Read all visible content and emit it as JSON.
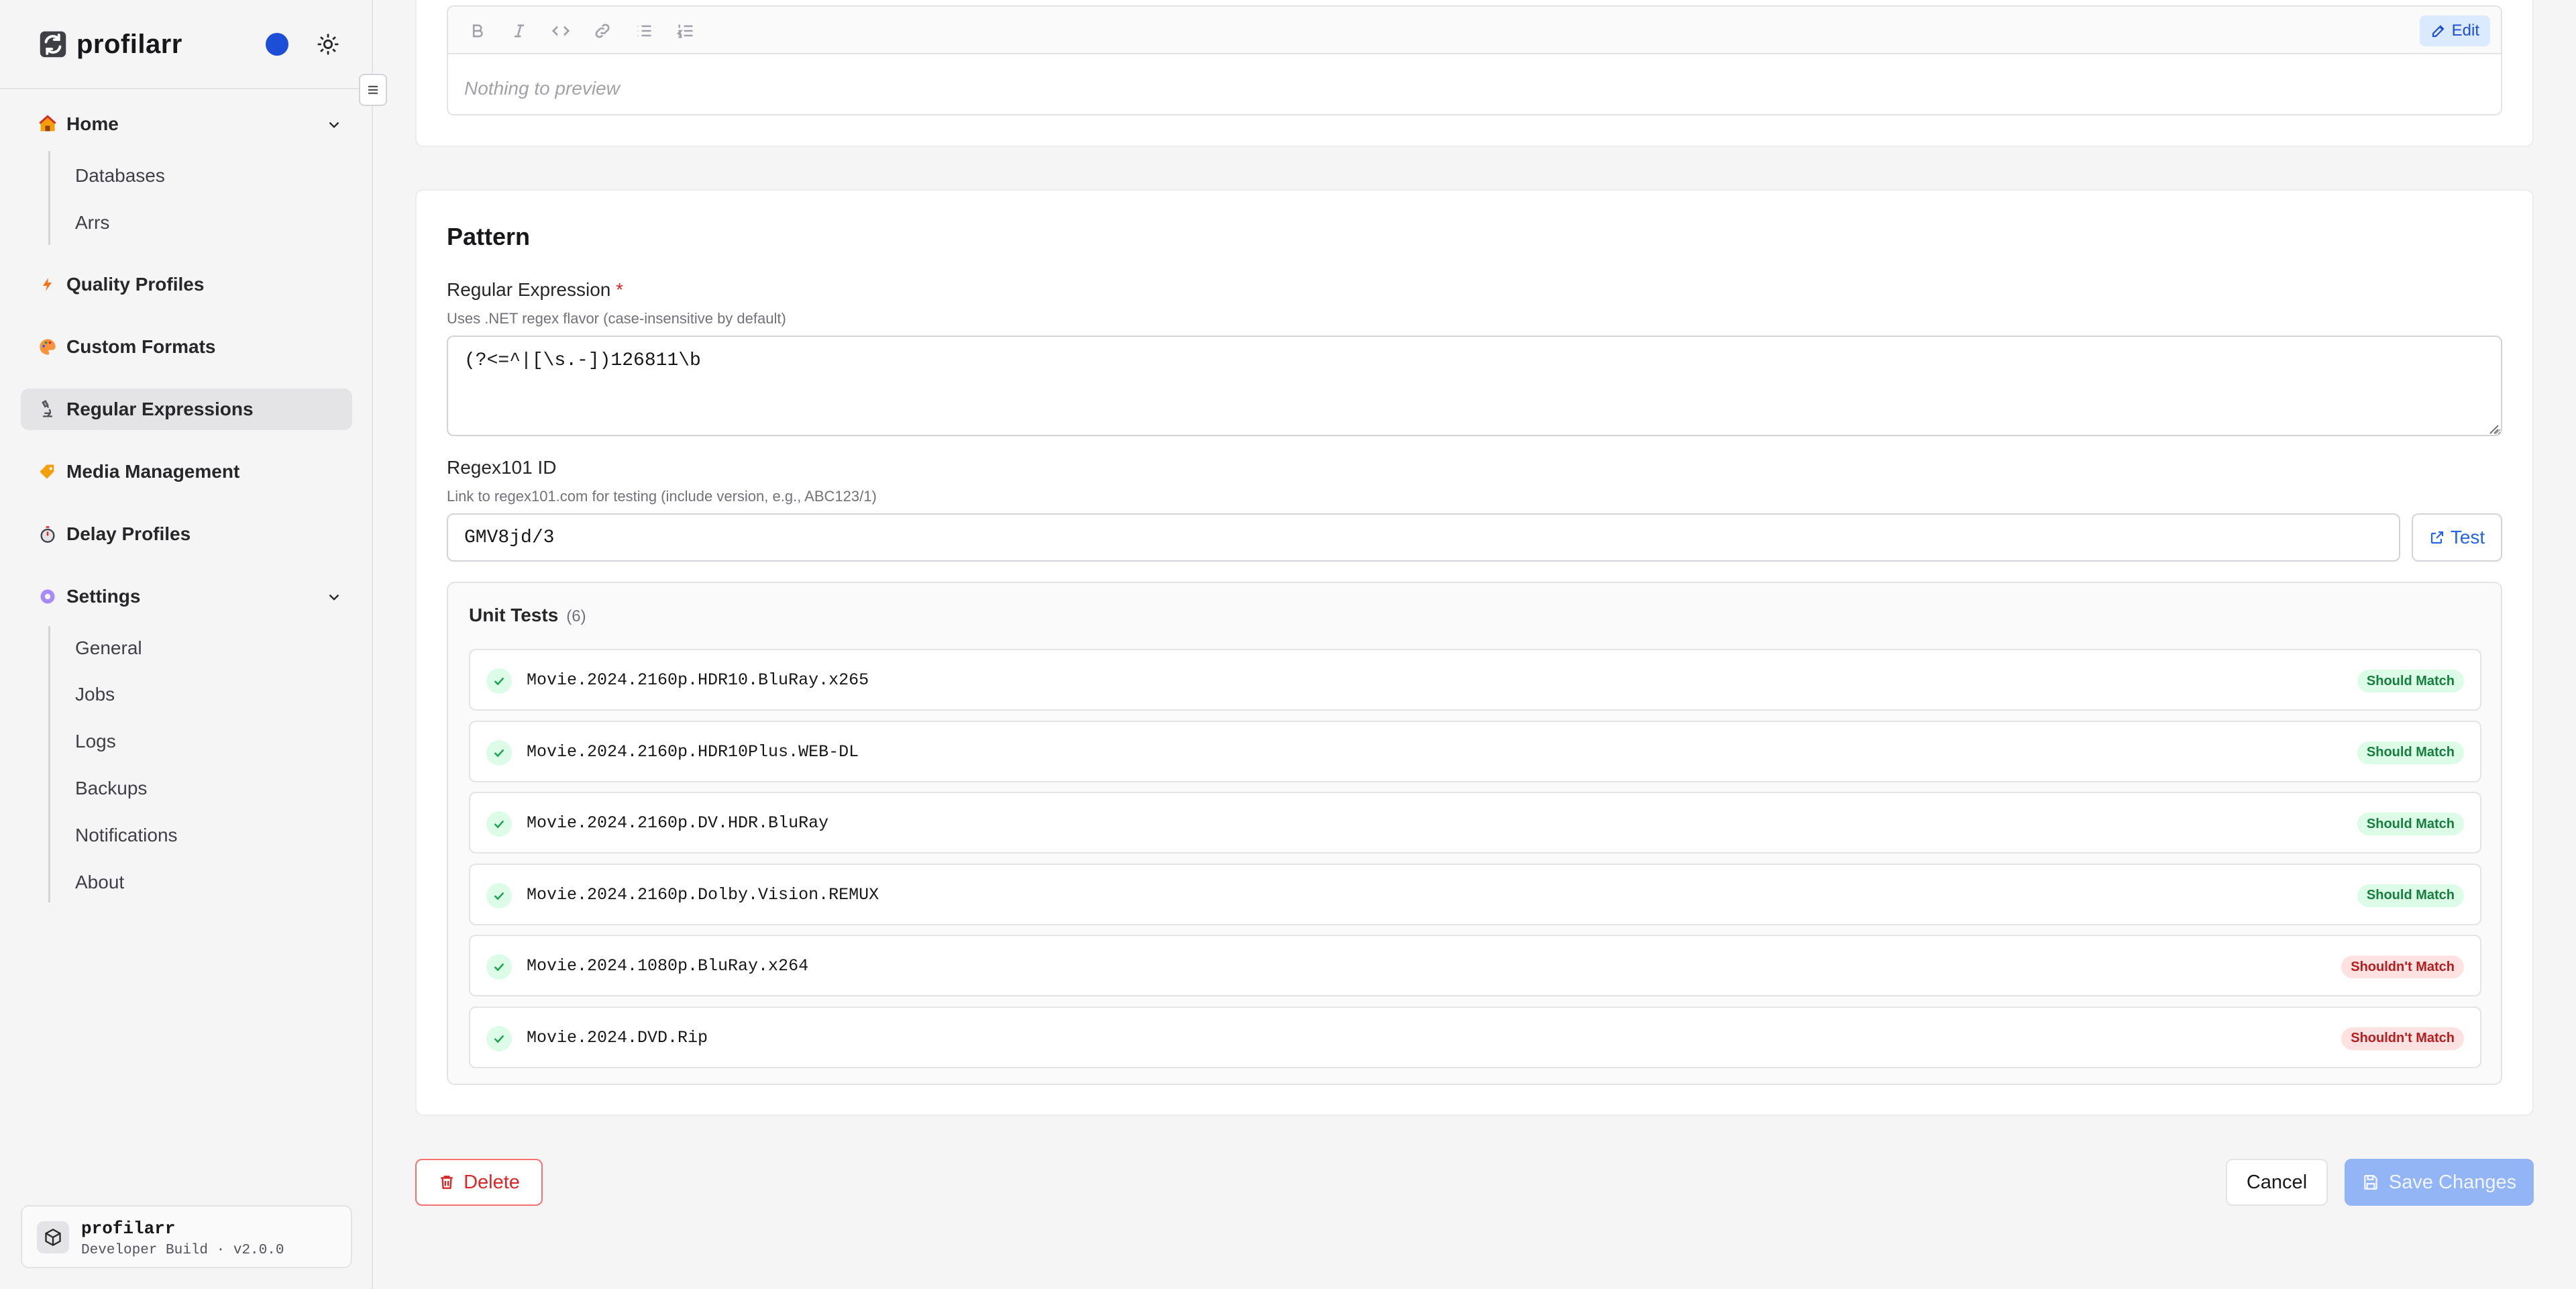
{
  "app": {
    "name": "profilarr"
  },
  "sidebar": {
    "groups": [
      {
        "label": "Home",
        "emoji": "house",
        "children": [
          "Databases",
          "Arrs"
        ]
      },
      {
        "label": "Quality Profiles",
        "emoji": "lightning"
      },
      {
        "label": "Custom Formats",
        "emoji": "palette"
      },
      {
        "label": "Regular Expressions",
        "emoji": "microscope",
        "active": true
      },
      {
        "label": "Media Management",
        "emoji": "label"
      },
      {
        "label": "Delay Profiles",
        "emoji": "stopwatch"
      },
      {
        "label": "Settings",
        "emoji": "gear",
        "children": [
          "General",
          "Jobs",
          "Logs",
          "Backups",
          "Notifications",
          "About"
        ]
      }
    ],
    "footer": {
      "name": "profilarr",
      "version": "Developer Build · v2.0.0"
    }
  },
  "editor": {
    "toolbar": [
      "bold-icon",
      "italic-icon",
      "code-icon",
      "link-icon",
      "bullet-list-icon",
      "numbered-list-icon"
    ],
    "edit_label": "Edit",
    "preview_placeholder": "Nothing to preview"
  },
  "pattern": {
    "title": "Pattern",
    "regex_label": "Regular Expression",
    "regex_required": "*",
    "regex_help": "Uses .NET regex flavor (case-insensitive by default)",
    "regex_value": "(?<=^|[\\s.-])126811\\b",
    "regex101_label": "Regex101 ID",
    "regex101_help": "Link to regex101.com for testing (include version, e.g., ABC123/1)",
    "regex101_value": "GMV8jd/3",
    "test_label": "Test"
  },
  "unit_tests": {
    "title": "Unit Tests",
    "count": "(6)",
    "items": [
      {
        "name": "Movie.2024.2160p.HDR10.BluRay.x265",
        "expect": "Should Match",
        "kind": "match"
      },
      {
        "name": "Movie.2024.2160p.HDR10Plus.WEB-DL",
        "expect": "Should Match",
        "kind": "match"
      },
      {
        "name": "Movie.2024.2160p.DV.HDR.BluRay",
        "expect": "Should Match",
        "kind": "match"
      },
      {
        "name": "Movie.2024.2160p.Dolby.Vision.REMUX",
        "expect": "Should Match",
        "kind": "match"
      },
      {
        "name": "Movie.2024.1080p.BluRay.x264",
        "expect": "Shouldn't Match",
        "kind": "nomatch"
      },
      {
        "name": "Movie.2024.DVD.Rip",
        "expect": "Shouldn't Match",
        "kind": "nomatch"
      }
    ]
  },
  "actions": {
    "delete": "Delete",
    "cancel": "Cancel",
    "save": "Save Changes"
  },
  "colors": {
    "accent": "#1d4ed8",
    "success": "#15803d",
    "danger": "#dc2626",
    "save_disabled": "#93b4f5"
  }
}
